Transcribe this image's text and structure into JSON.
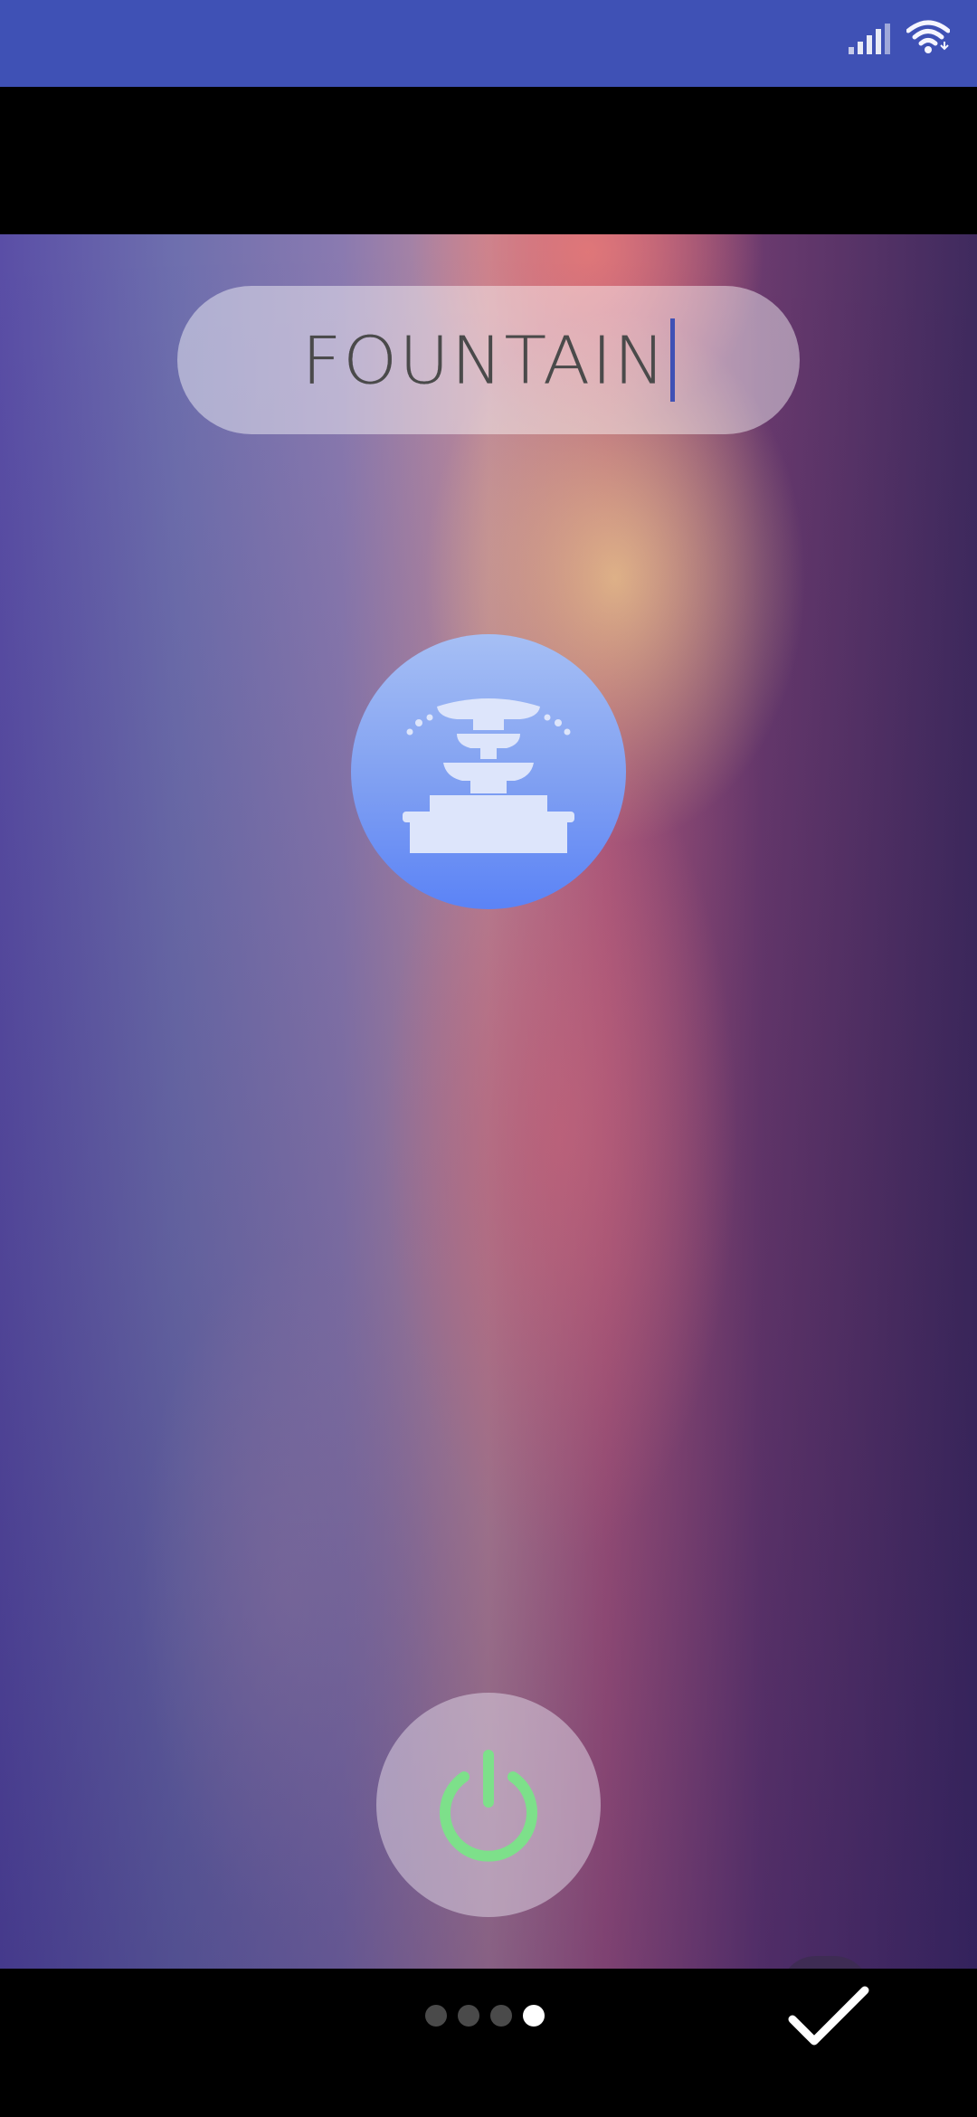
{
  "status_bar": {
    "color": "#3f51b5",
    "icons": [
      "signal-icon",
      "wifi-icon"
    ]
  },
  "name_field": {
    "value": "FOUNTAIN",
    "caret_color": "#3f51b5"
  },
  "device_icon": {
    "name": "fountain-icon",
    "gradient_top": "#a6bff4",
    "gradient_bottom": "#5b83f6"
  },
  "power_button": {
    "icon": "power-icon",
    "color": "#7de08a"
  },
  "pager": {
    "total": 4,
    "current": 4
  },
  "confirm_button": {
    "icon": "check-icon"
  }
}
